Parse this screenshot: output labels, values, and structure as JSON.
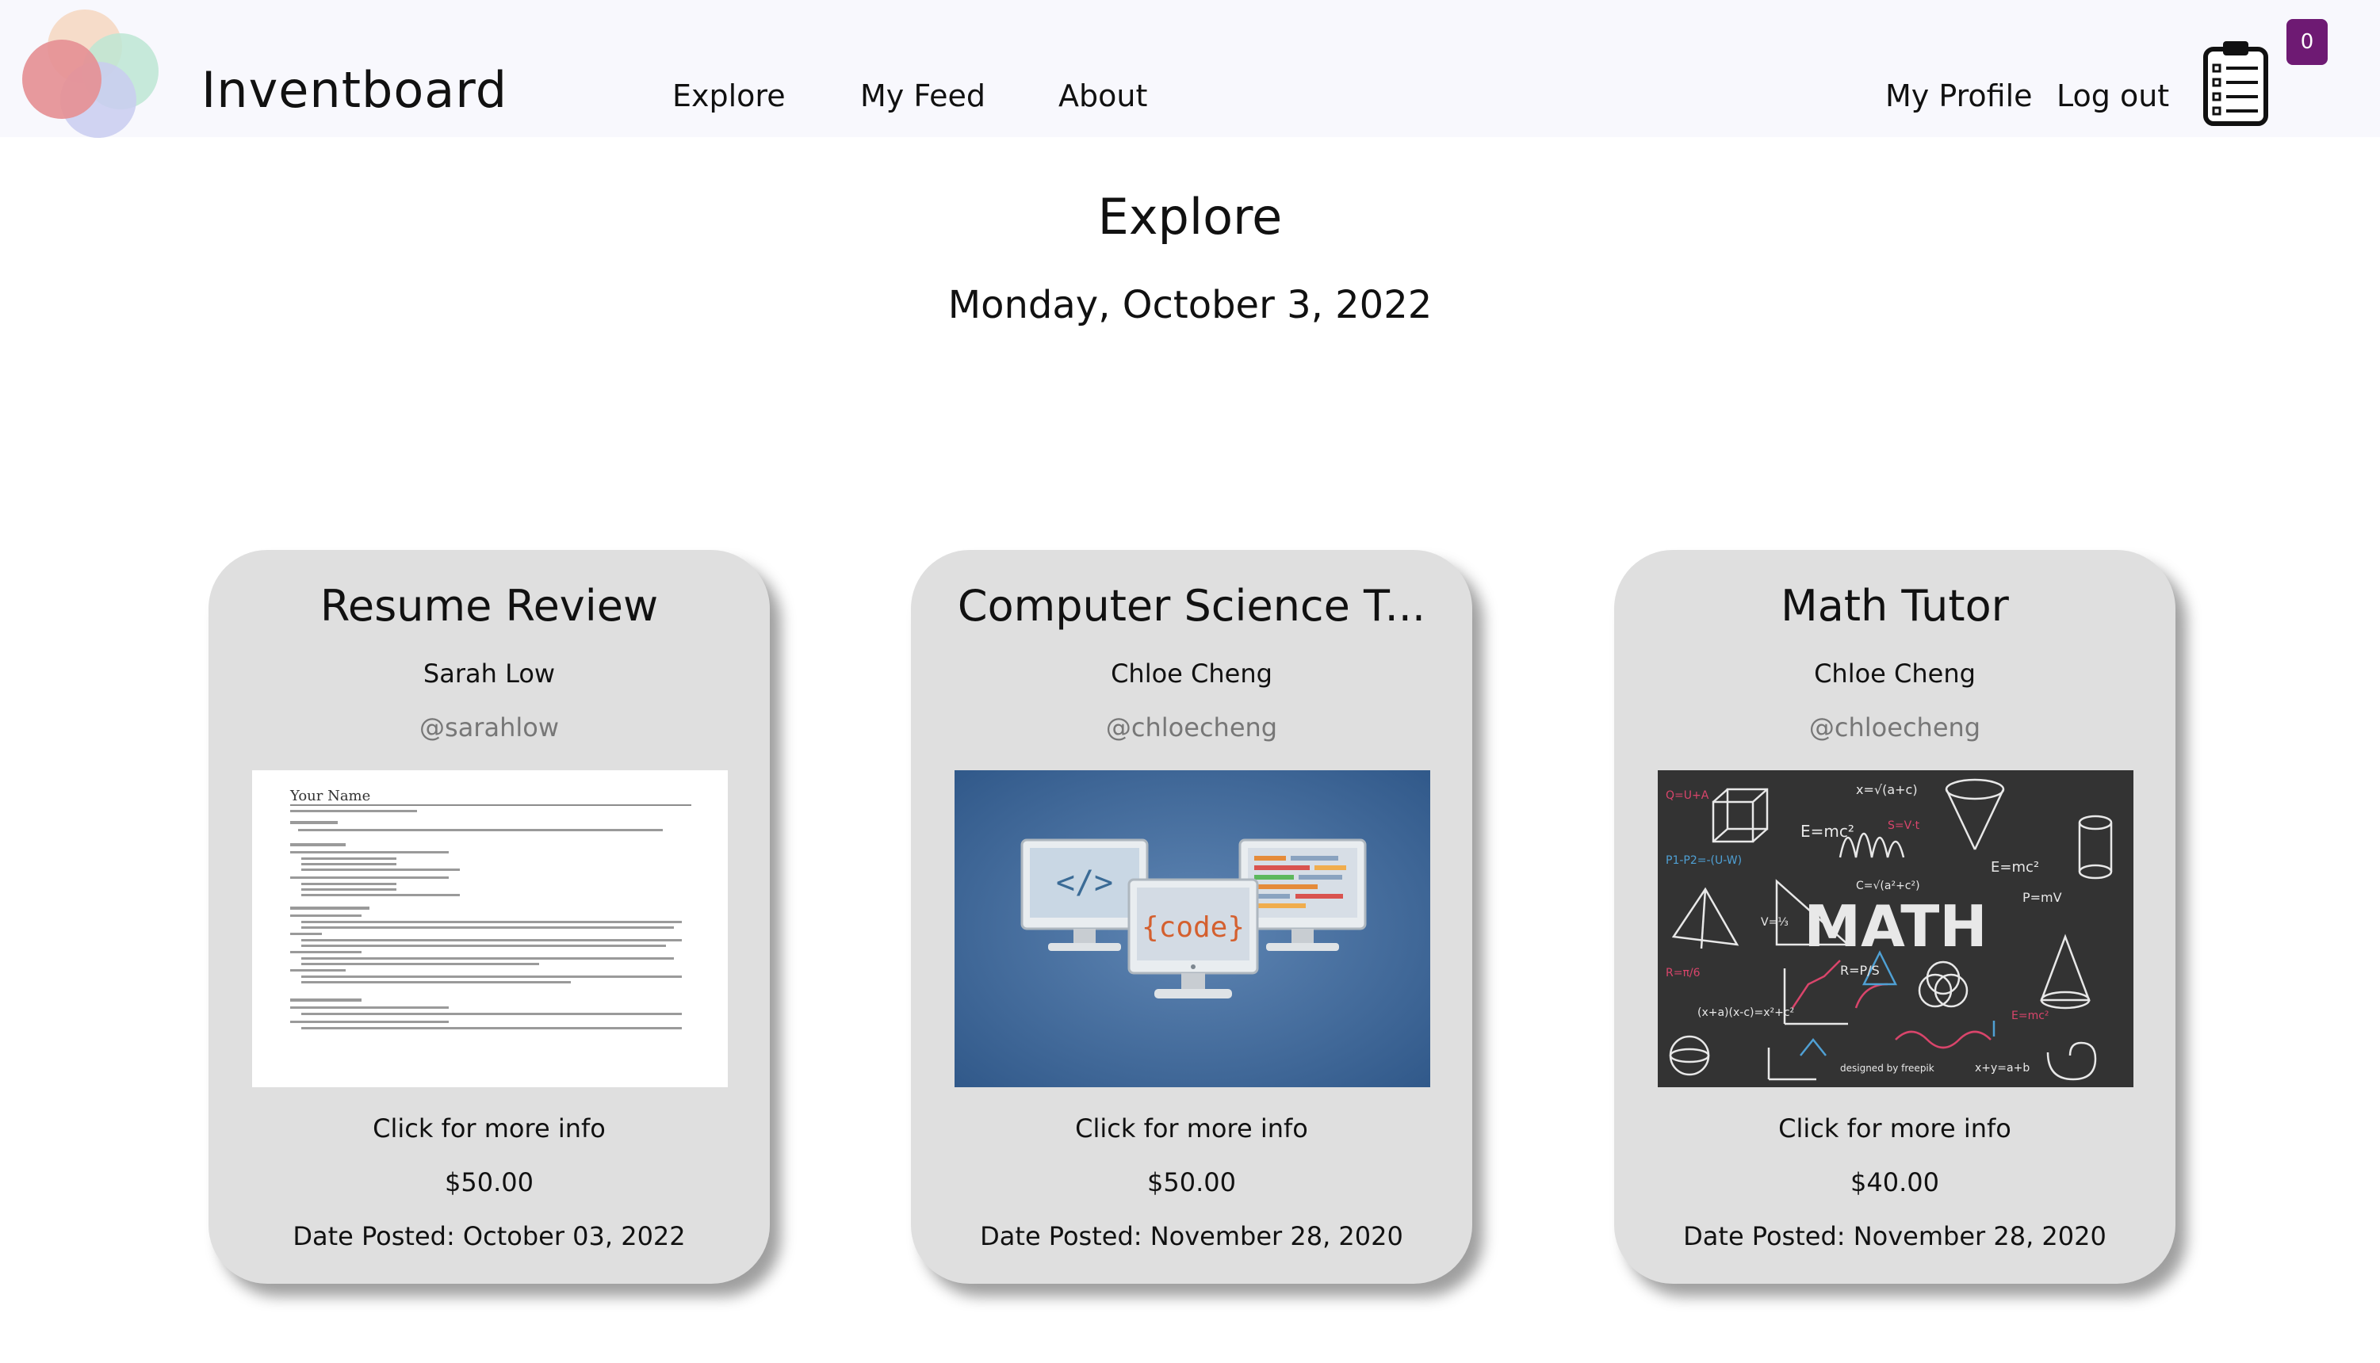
{
  "app": {
    "brand": "Inventboard",
    "colors": {
      "navbar_bg": "#f8f8fd",
      "badge_bg": "#6e1a73",
      "card_bg": "#dfdfdf",
      "handle_text": "#777777"
    }
  },
  "nav": {
    "links": [
      "Explore",
      "My Feed",
      "About"
    ],
    "profile_label": "My Profile",
    "logout_label": "Log out",
    "cart_icon": "clipboard-list-icon",
    "cart_count": "0"
  },
  "header": {
    "title": "Explore",
    "date": "Monday, October 3, 2022"
  },
  "cards": [
    {
      "title": "Resume Review",
      "owner": "Sarah Low",
      "handle": "@sarahlow",
      "image": "resume-document-thumbnail",
      "image_title": "Your Name",
      "info_label": "Click for more info",
      "price": "$50.00",
      "posted_label": "Date Posted:",
      "posted_date": "October 03, 2022"
    },
    {
      "title": "Computer Science T...",
      "owner": "Chloe Cheng",
      "handle": "@chloecheng",
      "image": "code-monitors-illustration",
      "image_title": "{code}",
      "info_label": "Click for more info",
      "price": "$50.00",
      "posted_label": "Date Posted:",
      "posted_date": "November 28, 2020"
    },
    {
      "title": "Math Tutor",
      "owner": "Chloe Cheng",
      "handle": "@chloecheng",
      "image": "math-chalkboard-illustration",
      "image_title": "MATH",
      "info_label": "Click for more info",
      "price": "$40.00",
      "posted_label": "Date Posted:",
      "posted_date": "November 28, 2020"
    }
  ]
}
